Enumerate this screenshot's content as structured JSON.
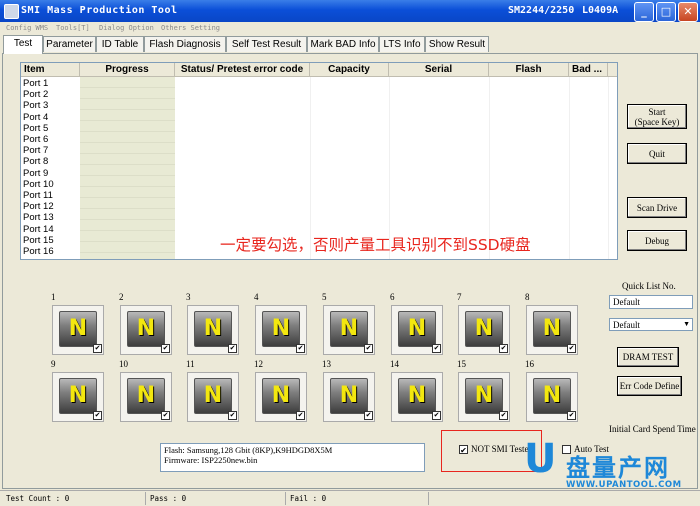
{
  "window": {
    "title": "SMI Mass Production Tool",
    "chip": "SM2244/2250",
    "version": "L0409A",
    "controls": {
      "minimize": "_",
      "maximize": "□",
      "close": "✕"
    }
  },
  "menu": {
    "items": [
      "Config WMS",
      "Tools[T]",
      "Dialog Option",
      "Others Setting"
    ]
  },
  "tabs": [
    {
      "label": "Test"
    },
    {
      "label": "Parameter"
    },
    {
      "label": "ID Table"
    },
    {
      "label": "Flash Diagnosis"
    },
    {
      "label": "Self Test Result"
    },
    {
      "label": "Mark BAD Info"
    },
    {
      "label": "LTS Info"
    },
    {
      "label": "Show Result"
    }
  ],
  "grid": {
    "columns": [
      "Item",
      "Progress",
      "Status/ Pretest error code",
      "Capacity",
      "Serial",
      "Flash",
      "Bad ..."
    ],
    "ports": [
      "Port 1",
      "Port 2",
      "Port 3",
      "Port 4",
      "Port 5",
      "Port 6",
      "Port 7",
      "Port 8",
      "Port 9",
      "Port 10",
      "Port 11",
      "Port 12",
      "Port 13",
      "Port 14",
      "Port 15",
      "Port 16"
    ]
  },
  "annotation": "一定要勾选，否则产量工具识别不到SSD硬盘",
  "buttons": {
    "start_line1": "Start",
    "start_line2": "(Space Key)",
    "quit": "Quit",
    "scan_drive": "Scan Drive",
    "debug": "Debug",
    "dram_test": "DRAM TEST",
    "err_code_define": "Err Code Define"
  },
  "ports_panel": {
    "tiles": [
      {
        "num": "1",
        "glyph": "N"
      },
      {
        "num": "2",
        "glyph": "N"
      },
      {
        "num": "3",
        "glyph": "N"
      },
      {
        "num": "4",
        "glyph": "N"
      },
      {
        "num": "5",
        "glyph": "N"
      },
      {
        "num": "6",
        "glyph": "N"
      },
      {
        "num": "7",
        "glyph": "N"
      },
      {
        "num": "8",
        "glyph": "N"
      },
      {
        "num": "9",
        "glyph": "N"
      },
      {
        "num": "10",
        "glyph": "N"
      },
      {
        "num": "11",
        "glyph": "N"
      },
      {
        "num": "12",
        "glyph": "N"
      },
      {
        "num": "13",
        "glyph": "N"
      },
      {
        "num": "14",
        "glyph": "N"
      },
      {
        "num": "15",
        "glyph": "N"
      },
      {
        "num": "16",
        "glyph": "N"
      }
    ],
    "check": "✔"
  },
  "quick_list": {
    "label": "Quick List No.",
    "input_value": "Default",
    "select_value": "Default",
    "arrow": "▼"
  },
  "initial_card_spend_time": "Initial Card Spend Time",
  "info": {
    "flash": "Flash:   Samsung,128 Gbit (8KP),K9HDGD8X5M",
    "firmware": "Firmware:   ISP2250new.bin"
  },
  "options": {
    "not_smi_tester": "NOT SMI Tester",
    "auto_test": "Auto Test"
  },
  "status_bar": {
    "test_count": "Test Count : 0",
    "pass": "Pass : 0",
    "fail": "Fail : 0"
  },
  "watermark": {
    "u": "U",
    "cn": "盘量产网",
    "en": "WWW.UPANTOOL.COM"
  }
}
